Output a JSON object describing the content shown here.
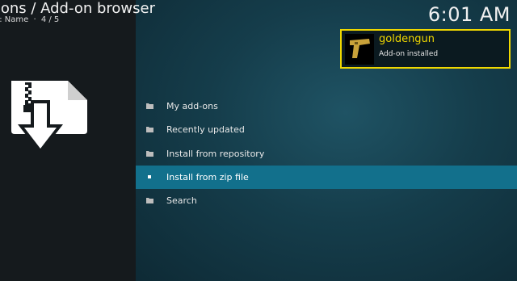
{
  "header": {
    "title": "-ons / Add-on browser",
    "sort_text": "y: Name",
    "separator": "·",
    "position": "4 / 5"
  },
  "clock": "6:01 AM",
  "notification": {
    "title": "goldengun",
    "message": "Add-on installed",
    "border_color": "#f0d800"
  },
  "menu": {
    "items": [
      {
        "label": "My add-ons",
        "icon": "folder-icon"
      },
      {
        "label": "Recently updated",
        "icon": "folder-icon"
      },
      {
        "label": "Install from repository",
        "icon": "folder-icon"
      },
      {
        "label": "Install from zip file",
        "icon": "bullet-icon",
        "selected": true
      },
      {
        "label": "Search",
        "icon": "folder-icon"
      }
    ],
    "highlight_color": "#12708c"
  },
  "left_icon": "zip-download-icon"
}
